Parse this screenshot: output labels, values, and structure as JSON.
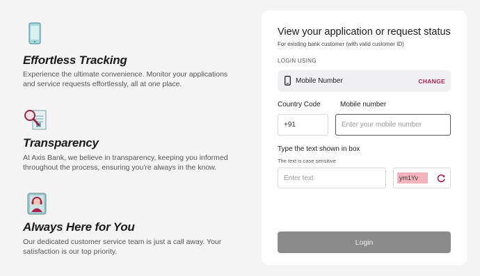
{
  "features": [
    {
      "icon": "phone-icon",
      "title": "Effortless Tracking",
      "description": "Experience the ultimate convenience. Monitor your applications and service requests effortlessly, all at one place."
    },
    {
      "icon": "magnifier-document-icon",
      "title": "Transparency",
      "description": "At Axis Bank, we believe in transparency, keeping you informed throughout the process, ensuring you're always in the know."
    },
    {
      "icon": "customer-support-icon",
      "title": "Always Here for You",
      "description": "Our dedicated customer service team is just a call away. Your satisfaction is our top priority."
    }
  ],
  "form": {
    "title": "View your application or request status",
    "subtitle": "For existing bank customer (with valid customer ID)",
    "login_using_label": "LOGIN USING",
    "method": {
      "icon": "mobile-phone-icon",
      "label": "Mobile Number",
      "change_label": "CHANGE"
    },
    "country_code_label": "Country Code",
    "country_code_value": "+91",
    "mobile_label": "Mobile number",
    "mobile_placeholder": "Enter your mobile number",
    "captcha_label": "Type the text shown in box",
    "captcha_hint": "The text is case sensitive",
    "captcha_placeholder": "Enter text",
    "captcha_code": "ym1Yv",
    "refresh_icon": "refresh-icon",
    "login_button": "Login"
  },
  "colors": {
    "accent": "#a8224d",
    "captcha_bg": "#f3b3bd",
    "button_disabled": "#8a8a8a"
  }
}
